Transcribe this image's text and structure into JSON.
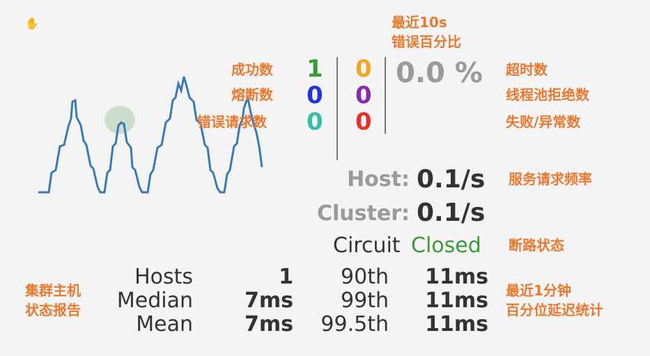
{
  "annotations": {
    "recent_error_pct_line1": "最近10s",
    "recent_error_pct_line2": "错误百分比",
    "success": "成功数",
    "short_circuited": "熔断数",
    "bad_request": "错误请求数",
    "timeout": "超时数",
    "rejected": "线程池拒绝数",
    "failure": "失败/异常数",
    "service_rate": "服务请求频率",
    "circuit_status": "断路状态",
    "host_report_line1": "集群主机",
    "host_report_line2": "状态报告",
    "latency_line1": "最近1分钟",
    "latency_line2": "百分位延迟统计"
  },
  "counters": {
    "success": "1",
    "short_circuited": "0",
    "bad_request": "0",
    "timeout": "0",
    "rejected": "0",
    "failure": "0"
  },
  "colors": {
    "success": "#3a9a3a",
    "short_circuited": "#2233dd",
    "bad_request": "#33c0a8",
    "timeout": "#f2a71d",
    "rejected": "#8a2aa8",
    "failure": "#e8302a",
    "annotation": "#e8792f",
    "circuit_closed": "#3a9a3a",
    "sparkline": "#3b78b8"
  },
  "error_percentage": "0.0 %",
  "rates": {
    "host_label": "Host:",
    "host_value": "0.1/s",
    "cluster_label": "Cluster:",
    "cluster_value": "0.1/s"
  },
  "circuit": {
    "label": "Circuit",
    "status": "Closed"
  },
  "stats": {
    "rows": [
      {
        "label": "Hosts",
        "value": "1",
        "pct_label": "90th",
        "pct_value": "11ms"
      },
      {
        "label": "Median",
        "value": "7ms",
        "pct_label": "99th",
        "pct_value": "11ms"
      },
      {
        "label": "Mean",
        "value": "7ms",
        "pct_label": "99.5th",
        "pct_value": "11ms"
      }
    ]
  }
}
